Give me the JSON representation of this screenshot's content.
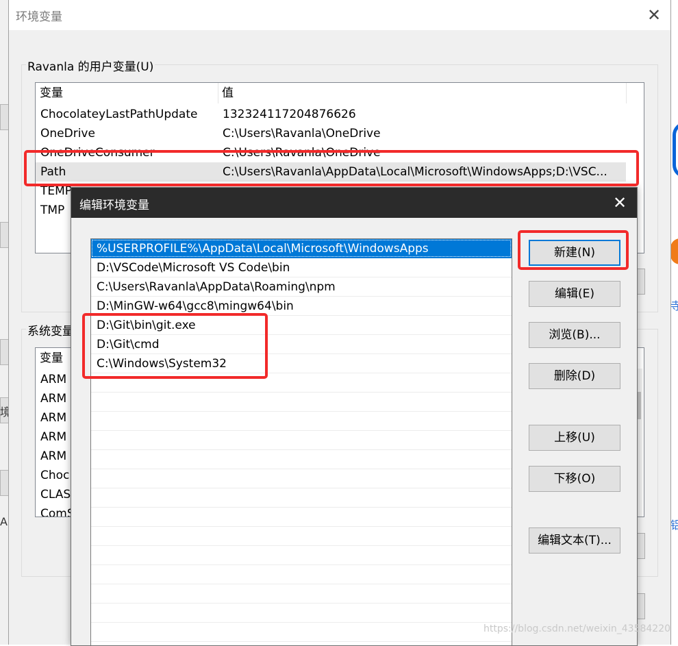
{
  "background": {
    "left_fragments": [
      "境",
      "A"
    ],
    "right_fragments": [
      "寺",
      "铝"
    ]
  },
  "env_window": {
    "title": "环境变量",
    "close_glyph": "✕",
    "user_group_label": "Ravanla 的用户变量(U)",
    "user_table": {
      "columns": [
        "变量",
        "值"
      ],
      "rows": [
        {
          "name": "ChocolateyLastPathUpdate",
          "value": "132324117204876626"
        },
        {
          "name": "OneDrive",
          "value": "C:\\Users\\Ravanla\\OneDrive"
        },
        {
          "name": "OneDriveConsumer",
          "value": "C:\\Users\\Ravanla\\OneDrive"
        },
        {
          "name": "Path",
          "value": "C:\\Users\\Ravanla\\AppData\\Local\\Microsoft\\WindowsApps;D:\\VSC..."
        },
        {
          "name": "TEMP",
          "value": ""
        },
        {
          "name": "TMP",
          "value": ""
        }
      ]
    },
    "system_group_label": "系统变量",
    "system_table": {
      "columns": [
        "变量"
      ],
      "rows": [
        "ARM",
        "ARM",
        "ARM",
        "ARM",
        "ARM",
        "Choc",
        "CLAS",
        "ComS"
      ]
    }
  },
  "edit_dialog": {
    "title": "编辑环境变量",
    "close_glyph": "✕",
    "paths": [
      "%USERPROFILE%\\AppData\\Local\\Microsoft\\WindowsApps",
      "D:\\VSCode\\Microsoft VS Code\\bin",
      "C:\\Users\\Ravanla\\AppData\\Roaming\\npm",
      "D:\\MinGW-w64\\gcc8\\mingw64\\bin",
      "D:\\Git\\bin\\git.exe",
      "D:\\Git\\cmd",
      "C:\\Windows\\System32"
    ],
    "selected_index": 0,
    "buttons": {
      "new": "新建(N)",
      "edit": "编辑(E)",
      "browse": "浏览(B)...",
      "delete": "删除(D)",
      "move_up": "上移(U)",
      "move_down": "下移(O)",
      "edit_text": "编辑文本(T)..."
    }
  },
  "watermark": "https://blog.csdn.net/weixin_43584220",
  "colors": {
    "selection_blue": "#0078d7",
    "annotation_red": "#f22a2a",
    "dialog_titlebar": "#2b2b2b"
  }
}
